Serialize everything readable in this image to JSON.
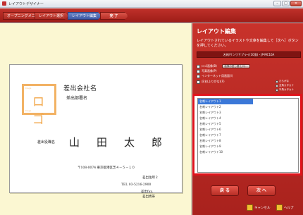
{
  "window": {
    "title": "レイアウトデザイナー",
    "buttons": [
      "–",
      "□",
      "✕"
    ]
  },
  "steps": [
    {
      "label": "オープニングメニュー",
      "state": "done"
    },
    {
      "label": "レイアウト選択",
      "state": "done"
    },
    {
      "label": "レイアウト編集",
      "state": "active"
    },
    {
      "label": "完 了",
      "state": "finish"
    }
  ],
  "card": {
    "logo_text": "ロゴ",
    "logo_corner": "Image",
    "company": "差出会社名",
    "department": "差出部署名",
    "role": "差出役職名",
    "name": "山田太郎",
    "address1": "〒108-0074 東京都港区芝４－５－１０",
    "address2": "差出住所２",
    "tel": "TEL 03-5216-2900",
    "fax": "差出fax.",
    "mail": "差出携帯"
  },
  "panel": {
    "title": "レイアウト編集",
    "description": "レイアウトされているイラストや文章を編集して［次へ］ボタンを押してください。",
    "paper_label": "名刺/サンワサプライ(10面)・JP-MC10A",
    "options": [
      {
        "label": "ロゴ画像(B)",
        "checked": true
      },
      {
        "label": "写真画像(P)",
        "checked": false
      },
      {
        "label": "インターネット用画面(I)",
        "checked": false
      },
      {
        "label": "氏名(ふりがな)(F)",
        "checked": false
      }
    ],
    "image_button": "画像の差し替え(G)...",
    "radios": [
      "ひらがな",
      "全角カタカナ",
      "半角カタカナ"
    ]
  },
  "layout_list": {
    "items": [
      "名刺レイアウト1",
      "名刺レイアウト2",
      "名刺レイアウト3",
      "名刺レイアウト4",
      "名刺レイアウト5",
      "名刺レイアウト6",
      "名刺レイアウト7",
      "名刺レイアウト8",
      "名刺レイアウト9",
      "名刺レイアウト10"
    ],
    "selected": "名刺レイアウト1"
  },
  "nav": {
    "back": "戻 る",
    "next": "次 へ"
  },
  "footer": {
    "cancel": "キャンセル",
    "help": "ヘルプ"
  },
  "colors": {
    "accent": "#b62e25",
    "preview_bg": "#fbf7d2",
    "selection": "#3b78d8",
    "highlight": "#e0141b"
  }
}
